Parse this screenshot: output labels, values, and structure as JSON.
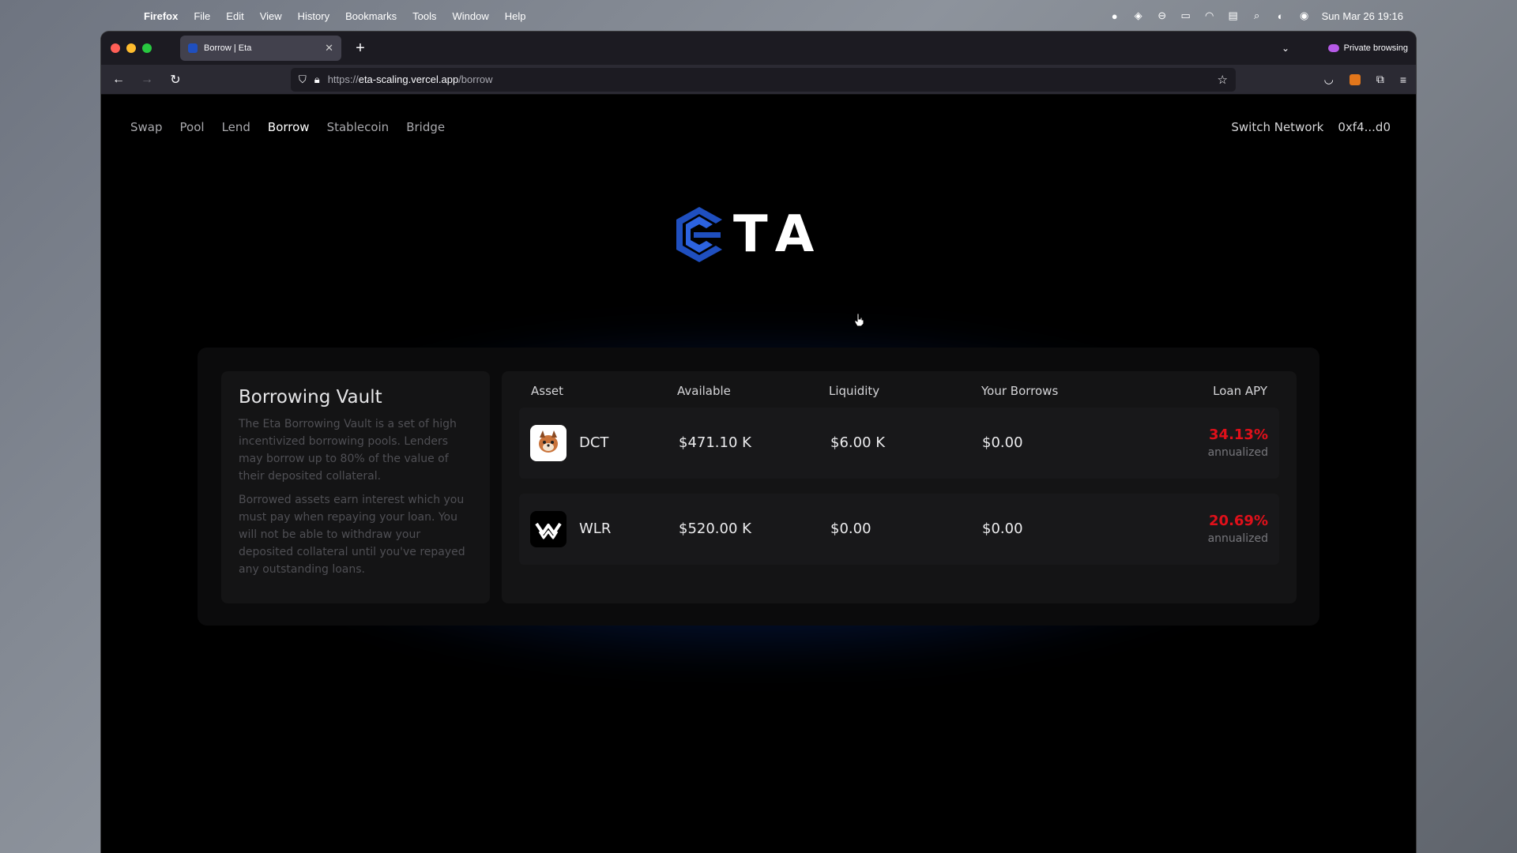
{
  "menubar": {
    "app": "Firefox",
    "items": [
      "File",
      "Edit",
      "View",
      "History",
      "Bookmarks",
      "Tools",
      "Window",
      "Help"
    ],
    "datetime": "Sun Mar 26  19:16"
  },
  "browser": {
    "tab_title": "Borrow | Eta",
    "private_label": "Private browsing",
    "url_scheme": "https://",
    "url_host": "eta-scaling.vercel.app",
    "url_path": "/borrow"
  },
  "site": {
    "nav": [
      "Swap",
      "Pool",
      "Lend",
      "Borrow",
      "Stablecoin",
      "Bridge"
    ],
    "active_nav": "Borrow",
    "switch_network": "Switch Network",
    "wallet": "0xf4...d0",
    "logo_text": "TA"
  },
  "vault": {
    "title": "Borrowing Vault",
    "para1": "The Eta Borrowing Vault is a set of high incentivized borrowing pools. Lenders may borrow up to 80% of the value of their deposited collateral.",
    "para2": "Borrowed assets earn interest which you must pay when repaying your loan. You will not be able to withdraw your deposited collateral until you've repayed any outstanding loans."
  },
  "table": {
    "headers": {
      "asset": "Asset",
      "available": "Available",
      "liquidity": "Liquidity",
      "borrows": "Your Borrows",
      "apy": "Loan APY"
    },
    "rows": [
      {
        "asset": "DCT",
        "available": "$471.10 K",
        "liquidity": "$6.00 K",
        "borrows": "$0.00",
        "apy": "34.13%",
        "apy_sub": "annualized"
      },
      {
        "asset": "WLR",
        "available": "$520.00 K",
        "liquidity": "$0.00",
        "borrows": "$0.00",
        "apy": "20.69%",
        "apy_sub": "annualized"
      }
    ]
  },
  "colors": {
    "accent_blue": "#1f4fbf",
    "apy_red": "#e0101a"
  }
}
